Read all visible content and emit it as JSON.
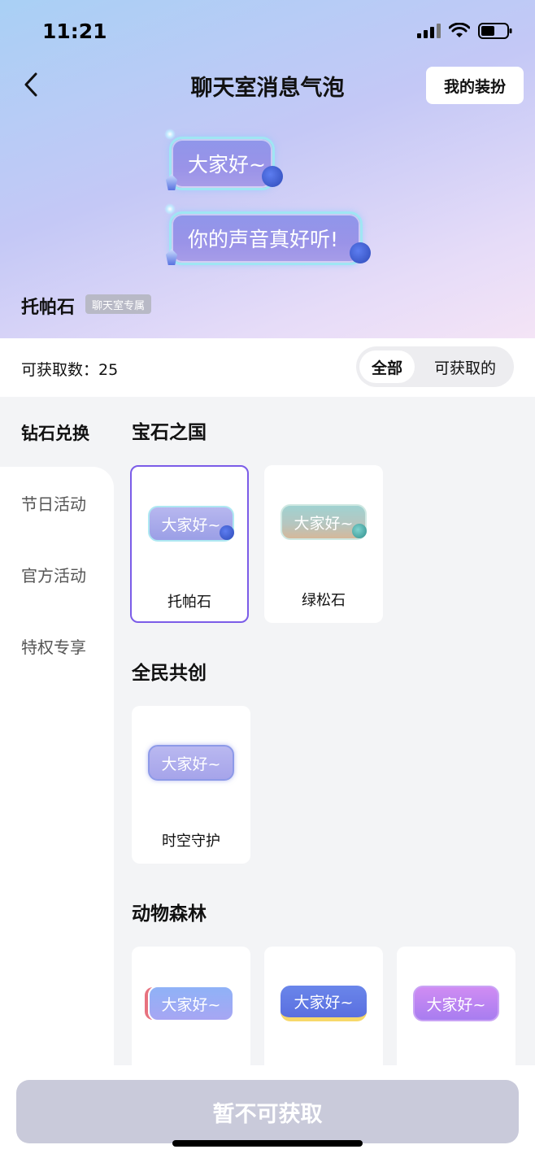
{
  "status": {
    "time": "11:21"
  },
  "nav": {
    "title": "聊天室消息气泡",
    "my_dress": "我的装扮"
  },
  "preview": {
    "bubble1": "大家好~",
    "bubble2": "你的声音真好听!",
    "item_name": "托帕石",
    "tag": "聊天室专属"
  },
  "count": {
    "text": "可获取数：25"
  },
  "filter": {
    "all": "全部",
    "gettable": "可获取的"
  },
  "sidebar": {
    "items": [
      {
        "label": "钻石兑换"
      },
      {
        "label": "节日活动"
      },
      {
        "label": "官方活动"
      },
      {
        "label": "特权专享"
      }
    ]
  },
  "sections": [
    {
      "title": "宝石之国",
      "cards": [
        {
          "bubble": "大家好~",
          "name": "托帕石"
        },
        {
          "bubble": "大家好~",
          "name": "绿松石"
        }
      ]
    },
    {
      "title": "全民共创",
      "cards": [
        {
          "bubble": "大家好~",
          "name": "时空守护"
        }
      ]
    },
    {
      "title": "动物森林",
      "cards": [
        {
          "bubble": "大家好~",
          "name": ""
        },
        {
          "bubble": "大家好~",
          "name": ""
        },
        {
          "bubble": "大家好~",
          "name": ""
        }
      ]
    }
  ],
  "cta": {
    "label": "暂不可获取"
  }
}
